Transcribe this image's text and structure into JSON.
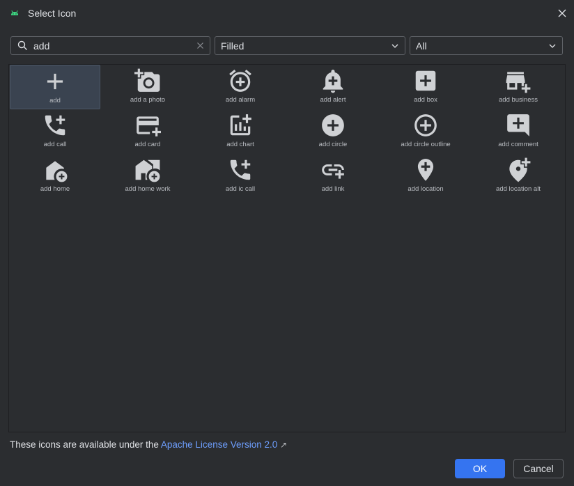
{
  "window": {
    "title": "Select Icon",
    "accent_color": "#3574f0",
    "app_icon": "android-icon"
  },
  "search": {
    "value": "add",
    "icon": "search-icon"
  },
  "style_select": {
    "selected": "Filled"
  },
  "category_select": {
    "selected": "All"
  },
  "icons": [
    {
      "name": "add",
      "icon": "plus-icon",
      "selected": true
    },
    {
      "name": "add a photo",
      "icon": "add-a-photo-icon"
    },
    {
      "name": "add alarm",
      "icon": "add-alarm-icon"
    },
    {
      "name": "add alert",
      "icon": "add-alert-icon"
    },
    {
      "name": "add box",
      "icon": "add-box-icon"
    },
    {
      "name": "add business",
      "icon": "add-business-icon"
    },
    {
      "name": "add call",
      "icon": "add-call-icon"
    },
    {
      "name": "add card",
      "icon": "add-card-icon"
    },
    {
      "name": "add chart",
      "icon": "add-chart-icon"
    },
    {
      "name": "add circle",
      "icon": "add-circle-icon"
    },
    {
      "name": "add circle outline",
      "icon": "add-circle-outline-icon"
    },
    {
      "name": "add comment",
      "icon": "add-comment-icon"
    },
    {
      "name": "add home",
      "icon": "add-home-icon"
    },
    {
      "name": "add home work",
      "icon": "add-home-work-icon"
    },
    {
      "name": "add ic call",
      "icon": "add-ic-call-icon"
    },
    {
      "name": "add link",
      "icon": "add-link-icon"
    },
    {
      "name": "add location",
      "icon": "add-location-icon"
    },
    {
      "name": "add location alt",
      "icon": "add-location-alt-icon"
    }
  ],
  "footer": {
    "text": "These icons are available under the ",
    "link": "Apache License Version 2.0",
    "ext_glyph": "↗"
  },
  "buttons": {
    "ok": "OK",
    "cancel": "Cancel"
  }
}
